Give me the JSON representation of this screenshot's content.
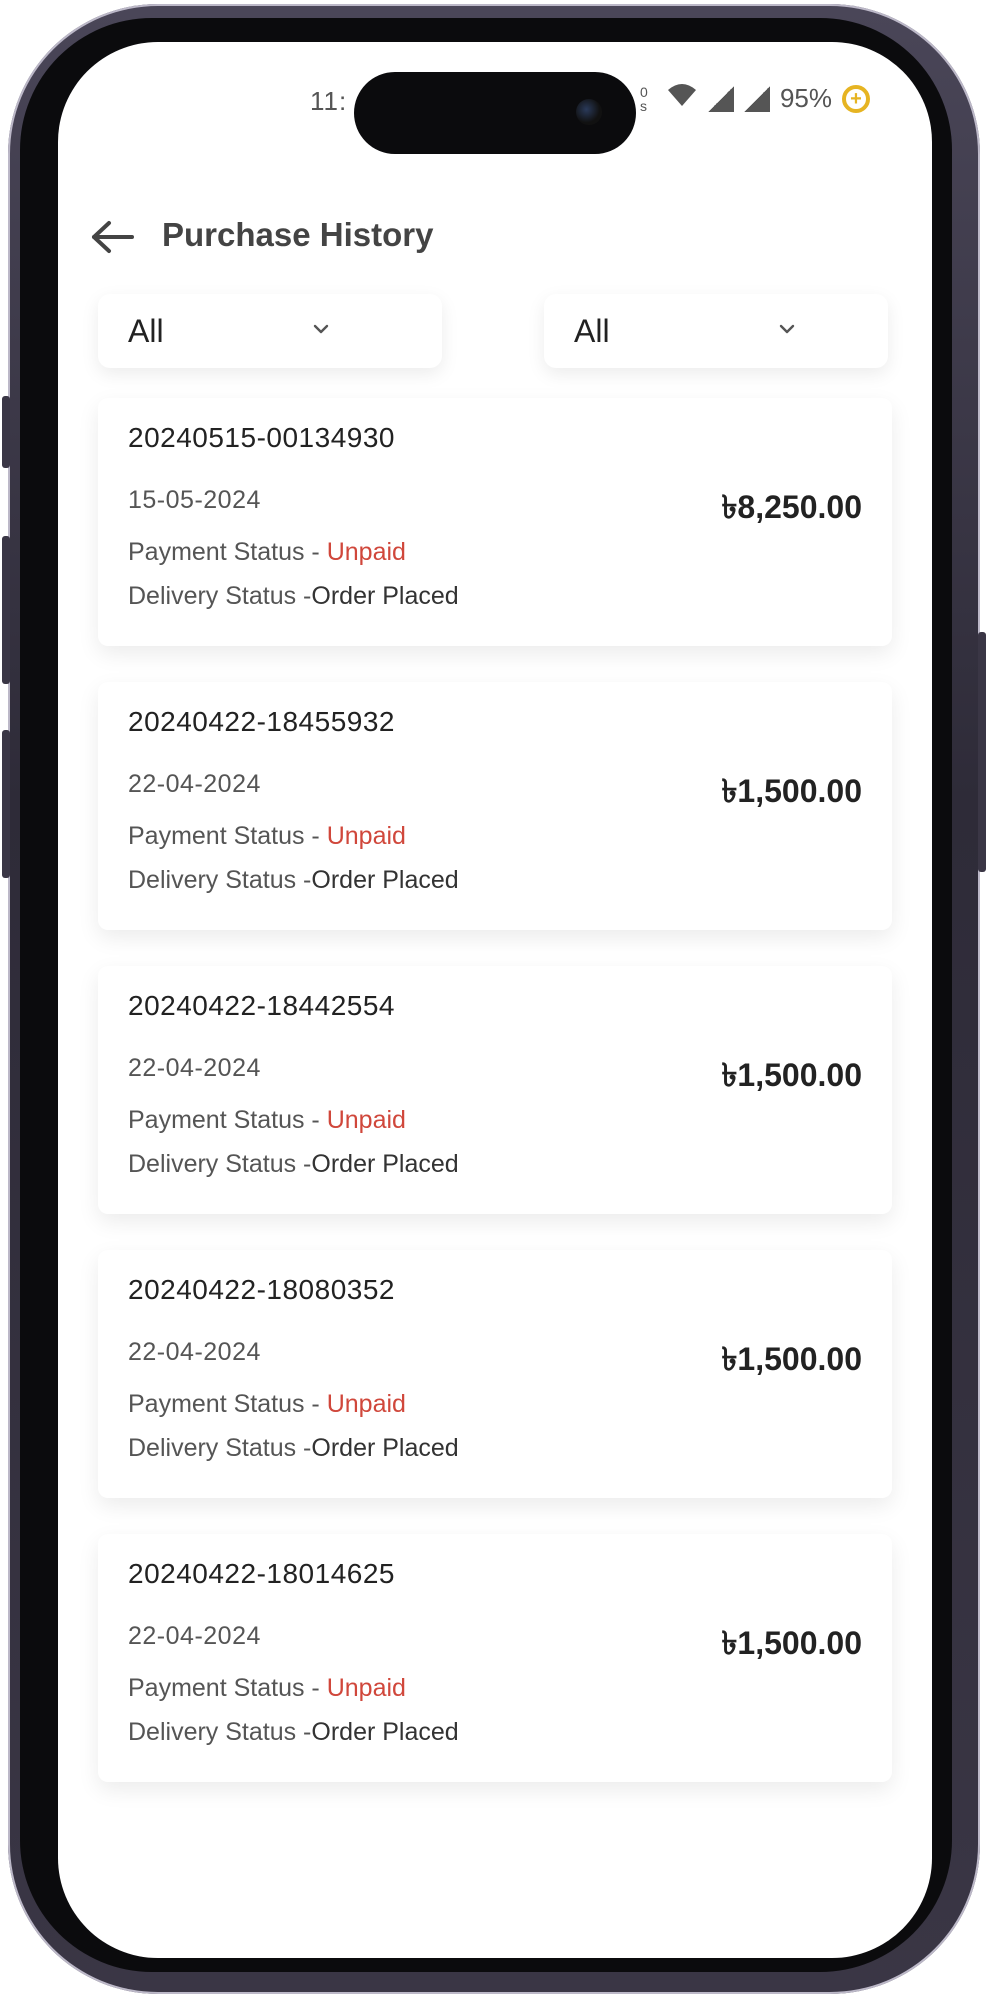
{
  "status_bar": {
    "time": "11:",
    "network": "0 s",
    "battery_percent": "95%",
    "battery_symbol": "+"
  },
  "header": {
    "title": "Purchase History"
  },
  "filters": {
    "first": "All",
    "second": "All"
  },
  "labels": {
    "payment_status_prefix": "Payment Status - ",
    "delivery_status_prefix": "Delivery Status -"
  },
  "orders": [
    {
      "id": "20240515-00134930",
      "date": "15-05-2024",
      "amount": "৳8,250.00",
      "payment_status": "Unpaid",
      "delivery_status": "Order Placed"
    },
    {
      "id": "20240422-18455932",
      "date": "22-04-2024",
      "amount": "৳1,500.00",
      "payment_status": "Unpaid",
      "delivery_status": "Order Placed"
    },
    {
      "id": "20240422-18442554",
      "date": "22-04-2024",
      "amount": "৳1,500.00",
      "payment_status": "Unpaid",
      "delivery_status": "Order Placed"
    },
    {
      "id": "20240422-18080352",
      "date": "22-04-2024",
      "amount": "৳1,500.00",
      "payment_status": "Unpaid",
      "delivery_status": "Order Placed"
    },
    {
      "id": "20240422-18014625",
      "date": "22-04-2024",
      "amount": "৳1,500.00",
      "payment_status": "Unpaid",
      "delivery_status": "Order Placed"
    }
  ],
  "colors": {
    "unpaid": "#d0473b",
    "battery_accent": "#e6b422",
    "title_text": "#444444"
  }
}
